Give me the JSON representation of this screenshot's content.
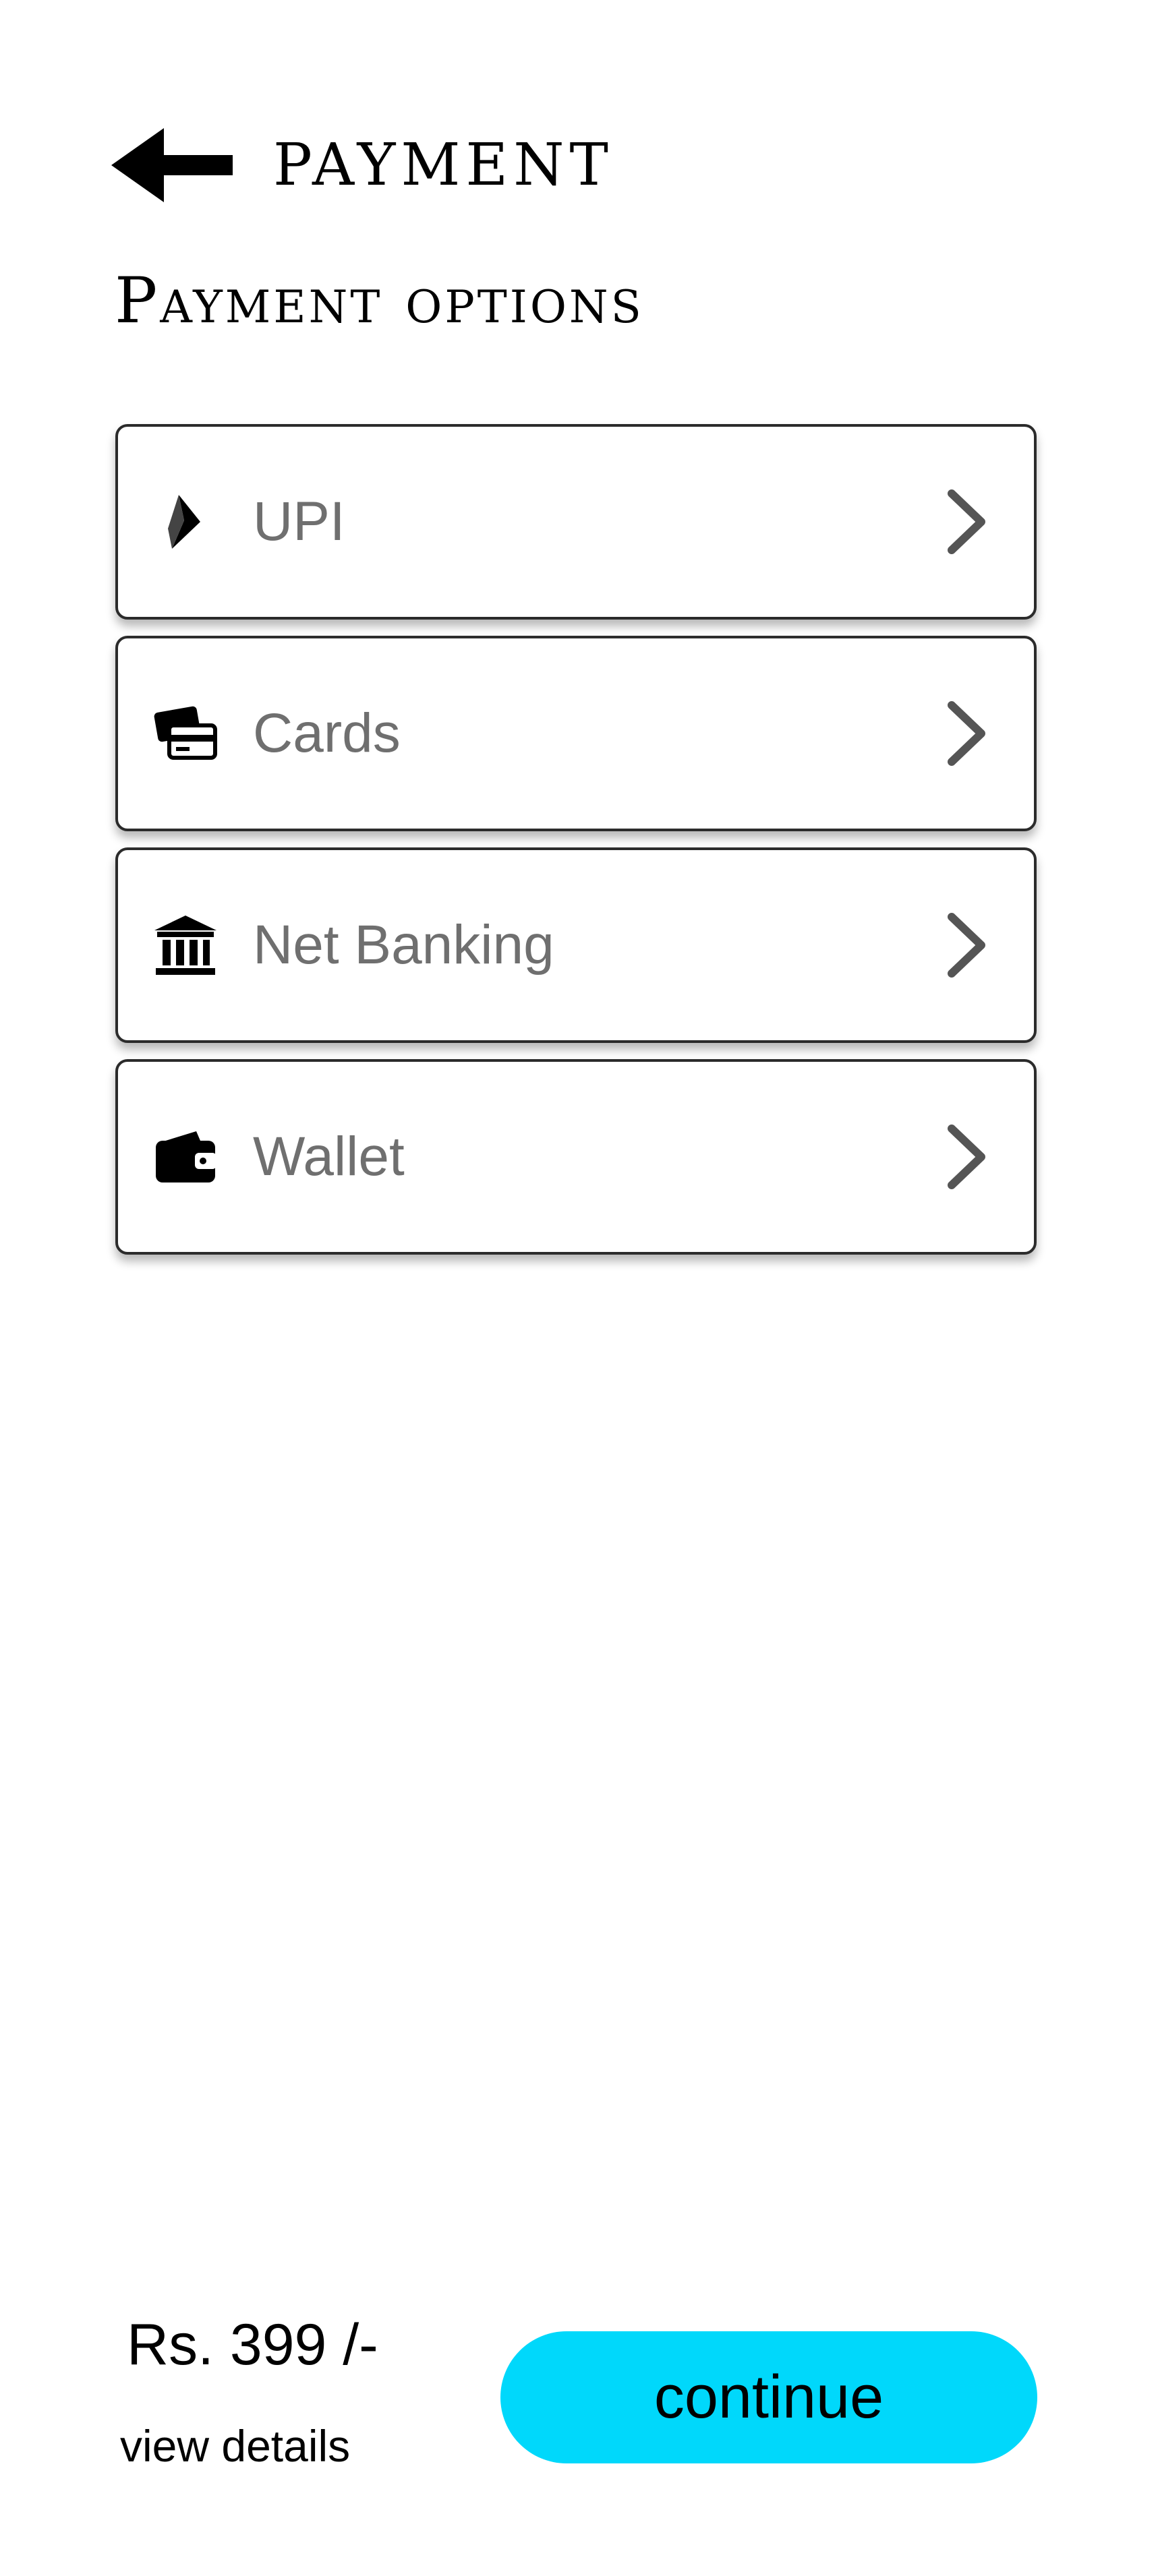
{
  "header": {
    "title": "PAYMENT",
    "back_icon": "arrow-left-icon"
  },
  "section": {
    "title": "Payment options"
  },
  "options": [
    {
      "label": "UPI",
      "icon": "upi-icon"
    },
    {
      "label": "Cards",
      "icon": "credit-card-icon"
    },
    {
      "label": "Net Banking",
      "icon": "bank-icon"
    },
    {
      "label": "Wallet",
      "icon": "wallet-icon"
    }
  ],
  "footer": {
    "price": "Rs. 399 /-",
    "view_details": "view details",
    "continue_label": "continue"
  },
  "colors": {
    "accent": "#00d8fb",
    "option_label": "#6f6f6f",
    "chevron": "#555555"
  }
}
